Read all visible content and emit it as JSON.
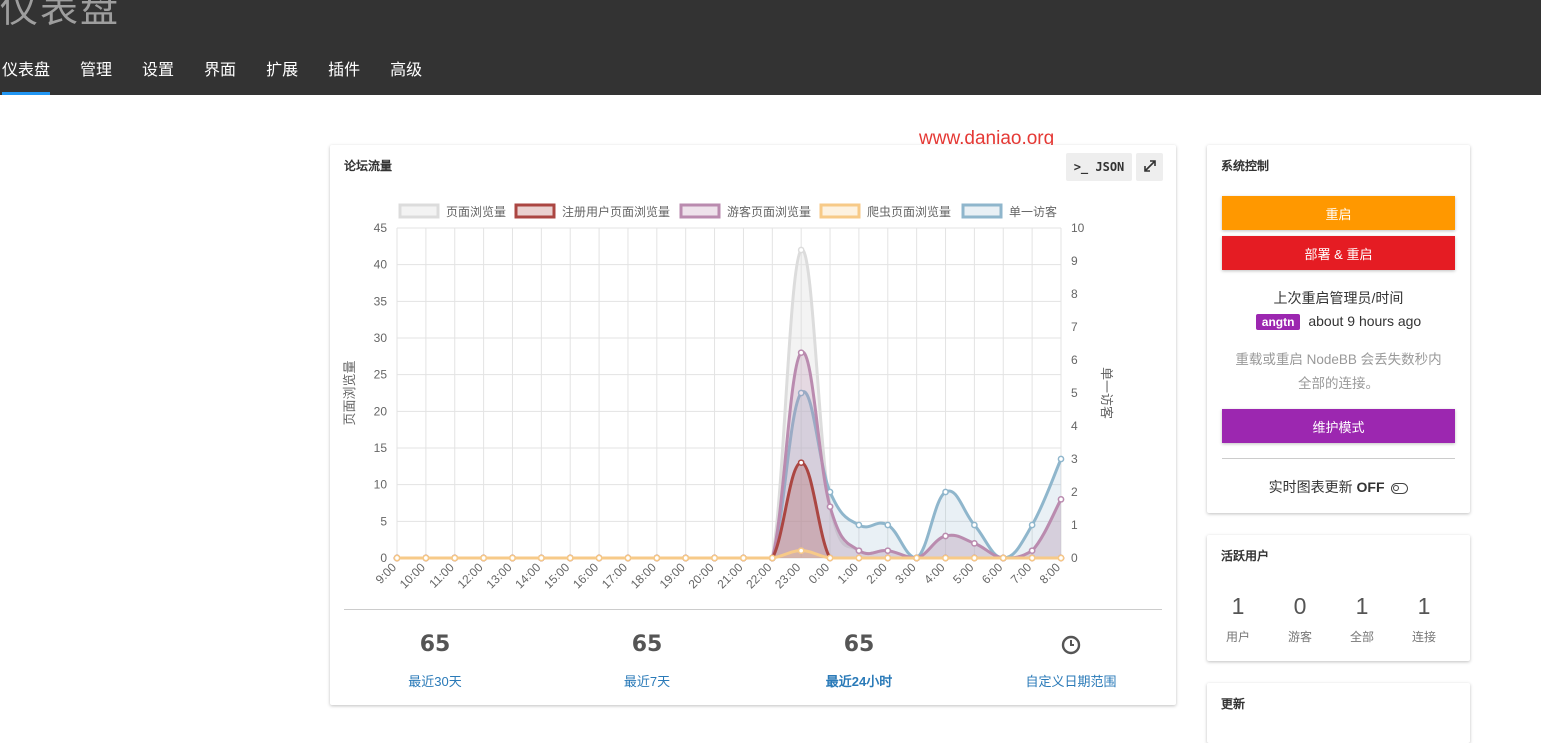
{
  "header": {
    "title": "仪表盘",
    "tabs": [
      {
        "label": "仪表盘",
        "active": true
      },
      {
        "label": "管理"
      },
      {
        "label": "设置"
      },
      {
        "label": "界面"
      },
      {
        "label": "扩展"
      },
      {
        "label": "插件"
      },
      {
        "label": "高级"
      }
    ]
  },
  "watermark": "www.daniao.org",
  "traffic": {
    "title": "论坛流量",
    "json_button": ">_ JSON",
    "expand_icon": "expand-icon",
    "stats": [
      {
        "value": "65",
        "label": "最近30天"
      },
      {
        "value": "65",
        "label": "最近7天"
      },
      {
        "value": "65",
        "label": "最近24小时",
        "active": true
      },
      {
        "value": "",
        "label": "自定义日期范围",
        "icon": "clock-icon"
      }
    ]
  },
  "chart_data": {
    "type": "line",
    "x": [
      "9:00",
      "10:00",
      "11:00",
      "12:00",
      "13:00",
      "14:00",
      "15:00",
      "16:00",
      "17:00",
      "18:00",
      "19:00",
      "20:00",
      "21:00",
      "22:00",
      "23:00",
      "0:00",
      "1:00",
      "2:00",
      "3:00",
      "4:00",
      "5:00",
      "6:00",
      "7:00",
      "8:00"
    ],
    "ylabel": "页面浏览量",
    "y2label": "单一访客",
    "ylim": [
      0,
      45
    ],
    "y2lim": [
      0,
      10
    ],
    "yticks": [
      0,
      5,
      10,
      15,
      20,
      25,
      30,
      35,
      40,
      45
    ],
    "y2ticks": [
      0,
      1,
      2,
      3,
      4,
      5,
      6,
      7,
      8,
      9,
      10
    ],
    "grid": true,
    "legend_position": "top",
    "series": [
      {
        "name": "页面浏览量",
        "axis": "left",
        "color": "#dcdcdc",
        "fill": "rgba(220,220,220,0.35)",
        "values": [
          0,
          0,
          0,
          0,
          0,
          0,
          0,
          0,
          0,
          0,
          0,
          0,
          0,
          0,
          42,
          7,
          1,
          1,
          0,
          3,
          2,
          0,
          1,
          8
        ]
      },
      {
        "name": "注册用户页面浏览量",
        "axis": "left",
        "color": "#ab4642",
        "fill": "rgba(171,70,66,0.25)",
        "values": [
          0,
          0,
          0,
          0,
          0,
          0,
          0,
          0,
          0,
          0,
          0,
          0,
          0,
          0,
          13,
          0,
          0,
          0,
          0,
          0,
          0,
          0,
          0,
          0
        ]
      },
      {
        "name": "游客页面浏览量",
        "axis": "left",
        "color": "#ba8baf",
        "fill": "rgba(186,139,175,0.25)",
        "values": [
          0,
          0,
          0,
          0,
          0,
          0,
          0,
          0,
          0,
          0,
          0,
          0,
          0,
          0,
          28,
          7,
          1,
          1,
          0,
          3,
          2,
          0,
          1,
          8
        ]
      },
      {
        "name": "爬虫页面浏览量",
        "axis": "left",
        "color": "#f7ca88",
        "fill": "rgba(247,202,136,0.25)",
        "values": [
          0,
          0,
          0,
          0,
          0,
          0,
          0,
          0,
          0,
          0,
          0,
          0,
          0,
          0,
          1,
          0,
          0,
          0,
          0,
          0,
          0,
          0,
          0,
          0
        ]
      },
      {
        "name": "单一访客",
        "axis": "right",
        "color": "#8fb6cc",
        "fill": "rgba(143,182,204,0.2)",
        "values": [
          0,
          0,
          0,
          0,
          0,
          0,
          0,
          0,
          0,
          0,
          0,
          0,
          0,
          0,
          5,
          2,
          1,
          1,
          0,
          2,
          1,
          0,
          1,
          3
        ]
      }
    ]
  },
  "system_control": {
    "title": "系统控制",
    "restart_label": "重启",
    "rebuild_label": "部署 & 重启",
    "restart_color": "#ff9800",
    "rebuild_color": "#e51c23",
    "last_restart_label": "上次重启管理员/时间",
    "last_restart_user": "angtn",
    "last_restart_time": "about 9 hours ago",
    "warning_line1": "重载或重启 NodeBB 会丢失数秒内",
    "warning_line2": "全部的连接。",
    "maintenance_label": "维护模式",
    "maintenance_color": "#9c27b0",
    "realtime_label": "实时图表更新",
    "realtime_state": "OFF"
  },
  "active_users": {
    "title": "活跃用户",
    "items": [
      {
        "value": "1",
        "label": "用户"
      },
      {
        "value": "0",
        "label": "游客"
      },
      {
        "value": "1",
        "label": "全部"
      },
      {
        "value": "1",
        "label": "连接"
      }
    ]
  },
  "updates": {
    "title": "更新"
  }
}
